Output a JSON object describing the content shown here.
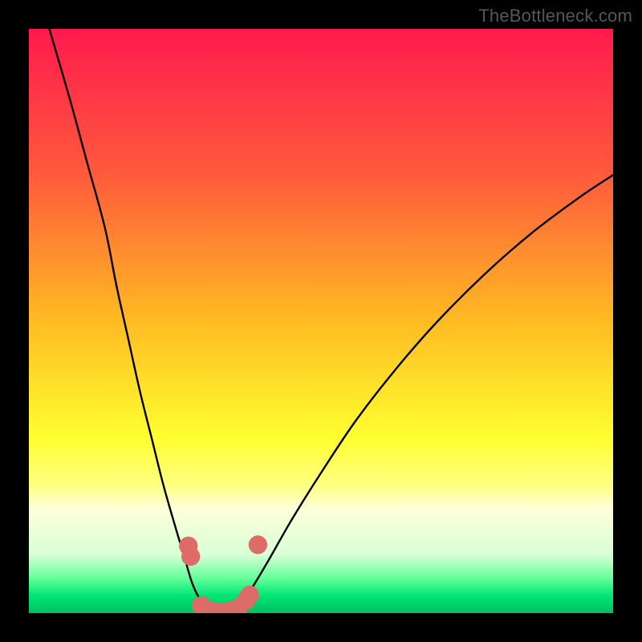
{
  "watermark": "TheBottleneck.com",
  "chart_data": {
    "type": "line",
    "title": "",
    "xlabel": "",
    "ylabel": "",
    "xlim": [
      0,
      100
    ],
    "ylim": [
      0,
      100
    ],
    "background_gradient_stops": [
      {
        "offset": 0.0,
        "color": "#ff1a4d"
      },
      {
        "offset": 0.25,
        "color": "#ff5a3c"
      },
      {
        "offset": 0.5,
        "color": "#ffbb22"
      },
      {
        "offset": 0.7,
        "color": "#ffff30"
      },
      {
        "offset": 0.78,
        "color": "#ffff80"
      },
      {
        "offset": 0.82,
        "color": "#ffffd8"
      },
      {
        "offset": 0.9,
        "color": "#d8ffd8"
      },
      {
        "offset": 0.94,
        "color": "#66ff99"
      },
      {
        "offset": 0.97,
        "color": "#00e676"
      },
      {
        "offset": 1.0,
        "color": "#00c060"
      }
    ],
    "series": [
      {
        "name": "left-branch",
        "color": "#000000",
        "points": [
          {
            "x": 3.5,
            "y": 100
          },
          {
            "x": 7,
            "y": 88
          },
          {
            "x": 10,
            "y": 77
          },
          {
            "x": 13,
            "y": 66
          },
          {
            "x": 15,
            "y": 56
          },
          {
            "x": 17,
            "y": 47
          },
          {
            "x": 19,
            "y": 38
          },
          {
            "x": 21,
            "y": 30
          },
          {
            "x": 23,
            "y": 22
          },
          {
            "x": 25,
            "y": 15
          },
          {
            "x": 26.5,
            "y": 10
          },
          {
            "x": 28,
            "y": 5
          },
          {
            "x": 29.5,
            "y": 2
          },
          {
            "x": 31,
            "y": 0.5
          }
        ]
      },
      {
        "name": "bottom-flat",
        "color": "#000000",
        "points": [
          {
            "x": 29,
            "y": 1
          },
          {
            "x": 31,
            "y": 0.3
          },
          {
            "x": 33,
            "y": 0.1
          },
          {
            "x": 35,
            "y": 0.3
          },
          {
            "x": 37,
            "y": 1
          }
        ]
      },
      {
        "name": "right-branch",
        "color": "#000000",
        "points": [
          {
            "x": 36,
            "y": 1
          },
          {
            "x": 38,
            "y": 4
          },
          {
            "x": 41,
            "y": 9
          },
          {
            "x": 45,
            "y": 16
          },
          {
            "x": 50,
            "y": 24
          },
          {
            "x": 56,
            "y": 33
          },
          {
            "x": 63,
            "y": 42
          },
          {
            "x": 70,
            "y": 50
          },
          {
            "x": 78,
            "y": 58
          },
          {
            "x": 86,
            "y": 65
          },
          {
            "x": 94,
            "y": 71
          },
          {
            "x": 100,
            "y": 75
          }
        ]
      }
    ],
    "markers": [
      {
        "x": 27.3,
        "y": 11.5,
        "r": 1.6,
        "color": "#dd6b68"
      },
      {
        "x": 27.7,
        "y": 9.7,
        "r": 1.6,
        "color": "#dd6b68"
      },
      {
        "x": 29.5,
        "y": 1.3,
        "r": 1.6,
        "color": "#dd6b68"
      },
      {
        "x": 30.2,
        "y": 0.7,
        "r": 1.6,
        "color": "#dd6b68"
      },
      {
        "x": 31.5,
        "y": 0.3,
        "r": 1.6,
        "color": "#dd6b68"
      },
      {
        "x": 33.0,
        "y": 0.2,
        "r": 1.6,
        "color": "#dd6b68"
      },
      {
        "x": 34.5,
        "y": 0.4,
        "r": 1.6,
        "color": "#dd6b68"
      },
      {
        "x": 35.8,
        "y": 0.9,
        "r": 1.6,
        "color": "#dd6b68"
      },
      {
        "x": 37.2,
        "y": 2.2,
        "r": 1.6,
        "color": "#dd6b68"
      },
      {
        "x": 37.8,
        "y": 3.1,
        "r": 1.6,
        "color": "#dd6b68"
      },
      {
        "x": 39.2,
        "y": 11.7,
        "r": 1.6,
        "color": "#dd6b68"
      }
    ]
  }
}
